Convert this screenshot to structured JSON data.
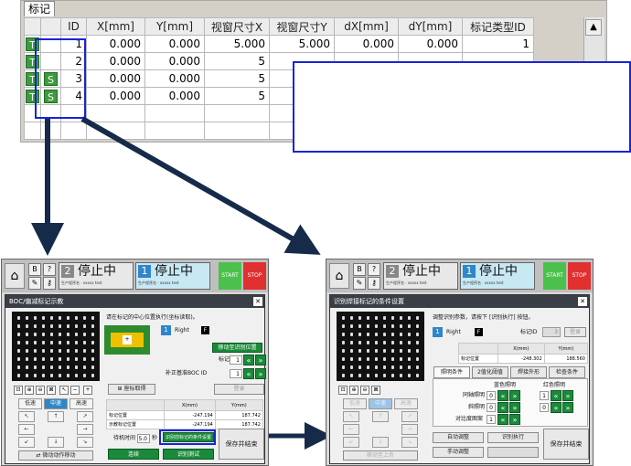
{
  "marker_table": {
    "tab_label": "标记",
    "columns": [
      "",
      "",
      "ID",
      "X[mm]",
      "Y[mm]",
      "视窗尺寸X",
      "视窗尺寸Y",
      "dX[mm]",
      "dY[mm]",
      "标记类型ID"
    ],
    "rows": [
      {
        "b1": "T",
        "b2": "",
        "id": "1",
        "x": "0.000",
        "y": "0.000",
        "wx": "5.000",
        "wy": "5.000",
        "dx": "0.000",
        "dy": "0.000",
        "type": "1"
      },
      {
        "b1": "T",
        "b2": "",
        "id": "2",
        "x": "0.000",
        "y": "0.000",
        "wx": "5",
        "wy": "",
        "dx": "",
        "dy": "",
        "type": ""
      },
      {
        "b1": "T",
        "b2": "S",
        "id": "3",
        "x": "0.000",
        "y": "0.000",
        "wx": "5",
        "wy": "",
        "dx": "",
        "dy": "",
        "type": ""
      },
      {
        "b1": "T",
        "b2": "S",
        "id": "4",
        "x": "0.000",
        "y": "0.000",
        "wx": "5",
        "wy": "",
        "dx": "",
        "dy": "",
        "type": ""
      }
    ],
    "scroll_up_icon": "triangle-up"
  },
  "common_header": {
    "status1_num": "2",
    "status1_label": "停止中",
    "status2_num": "1",
    "status2_label": "停止中",
    "start_label": "START",
    "stop_label": "STOP"
  },
  "left_panel": {
    "title": "BOC/偏减标记示教",
    "instruction": "请在标记的中心位置执行(坐标读取)。",
    "side_num": "1",
    "side_label": "Right",
    "f_badge": "F",
    "move_button": "移动至识别位置",
    "mark_id_label": "标记ID",
    "mark_id_value": "1",
    "boc_id_label": "补正基准BOC ID",
    "boc_id_value": "1",
    "coord_read_button": "座标取得",
    "register_button": "登录",
    "speed_low": "低速",
    "speed_mid": "中速",
    "speed_high": "高速",
    "table_header_x": "X(mm)",
    "table_header_y": "Y(mm)",
    "row1_label": "标记位置",
    "row1_x": "-247.194",
    "row1_y": "187.742",
    "row2_label": "示教标记位置",
    "row2_x": "-247.194",
    "row2_y": "187.742",
    "wait_label": "待机时间",
    "wait_value": "5.0",
    "wait_unit": "秒",
    "cond_button": "识别前标记的条件设置",
    "move_op_button": "微动动作移动",
    "continue_button": "连续",
    "test_button": "识别测试",
    "save_button": "保存并结束"
  },
  "right_panel": {
    "title": "识别焊接标记的条件设置",
    "instruction": "调整识别参数，请按下 [识别执行] 按钮。",
    "side_num": "1",
    "side_label": "Right",
    "f_badge": "F",
    "mark_id_label": "标记ID",
    "mark_id_value": "3",
    "register_button": "登录",
    "header_x": "X(mm)",
    "header_y": "Y(mm)",
    "pos_label": "标记位置",
    "pos_x": "-248.302",
    "pos_y": "188.560",
    "tabs": [
      "照明条件",
      "2值化阈值",
      "焊接外形",
      "检查条件"
    ],
    "blue_label": "蓝色照明",
    "red_label": "红色照明",
    "light1_label": "同轴照明",
    "light1_value": "0",
    "light1_red": "1",
    "light2_label": "斜照明",
    "light2_value": "0",
    "light2_red": "0",
    "contrast_label": "对比度图案",
    "contrast_value": "1",
    "speed_low": "低速",
    "speed_mid": "中速",
    "speed_high": "高速",
    "move_upper_button": "移动至上负",
    "auto_adjust_button": "自动调整",
    "exec_button": "识别执行",
    "manual_button": "手动调整",
    "save_button": "保存并结束"
  }
}
